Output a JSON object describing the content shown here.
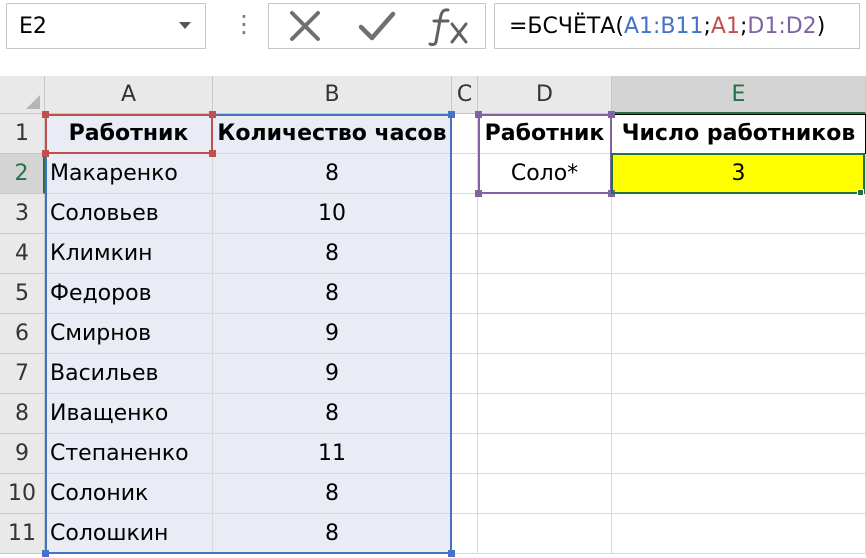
{
  "formula_bar": {
    "name_box": "E2",
    "cancel_icon": "x-icon",
    "enter_icon": "checkmark-icon",
    "function_icon": "fx-icon",
    "formula_parts": [
      {
        "text": "=БСЧЁТА(",
        "color": "#000000"
      },
      {
        "text": "A1:B11",
        "color": "#4472c4"
      },
      {
        "text": ";",
        "color": "#000000"
      },
      {
        "text": "A1",
        "color": "#c0504d"
      },
      {
        "text": ";",
        "color": "#000000"
      },
      {
        "text": "D1:D2",
        "color": "#8064a2"
      },
      {
        "text": ")",
        "color": "#000000"
      }
    ]
  },
  "columns": [
    "A",
    "B",
    "C",
    "D",
    "E"
  ],
  "rows": [
    "1",
    "2",
    "3",
    "4",
    "5",
    "6",
    "7",
    "8",
    "9",
    "10",
    "11"
  ],
  "table": {
    "header": [
      "Работник",
      "Количество часов"
    ],
    "data": [
      [
        "Макаренко",
        "8"
      ],
      [
        "Соловьев",
        "10"
      ],
      [
        "Климкин",
        "8"
      ],
      [
        "Федоров",
        "8"
      ],
      [
        "Смирнов",
        "9"
      ],
      [
        "Васильев",
        "9"
      ],
      [
        "Иващенко",
        "8"
      ],
      [
        "Степаненко",
        "11"
      ],
      [
        "Солоник",
        "8"
      ],
      [
        "Солошкин",
        "8"
      ]
    ]
  },
  "criteria": {
    "header": "Работник",
    "value": "Соло*"
  },
  "result": {
    "header": "Число работников",
    "value": "3"
  },
  "colors": {
    "range_blue": "#4472c4",
    "range_red": "#c0504d",
    "range_purple": "#8064a2",
    "active_green": "#217346",
    "result_fill": "#ffff00"
  }
}
